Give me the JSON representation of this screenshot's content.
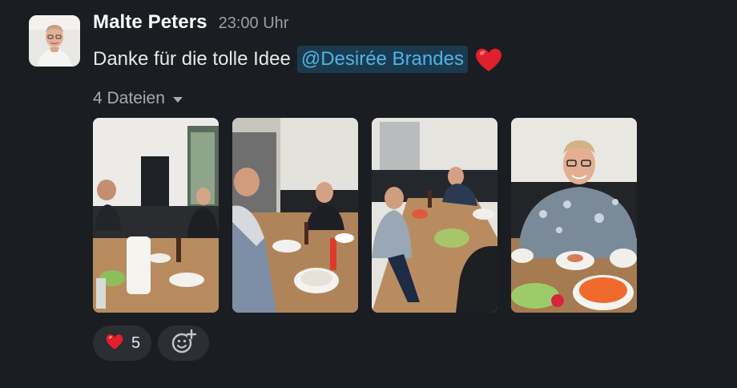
{
  "message": {
    "author": "Malte Peters",
    "time": "23:00 Uhr",
    "text": "Danke für die tolle Idee",
    "mention": "@Desirée Brandes",
    "files_label": "4 Dateien"
  },
  "icons": {
    "heart": "red-heart-emoji",
    "add_reaction": "add-reaction-icon",
    "caret": "chevron-down-icon"
  },
  "colors": {
    "background": "#1a1d21",
    "mention_bg": "#1c3a4f",
    "mention_text": "#4fb4e6",
    "reaction_bg": "#2b2e33"
  },
  "reactions": [
    {
      "emoji": "red-heart",
      "count": "5"
    }
  ]
}
